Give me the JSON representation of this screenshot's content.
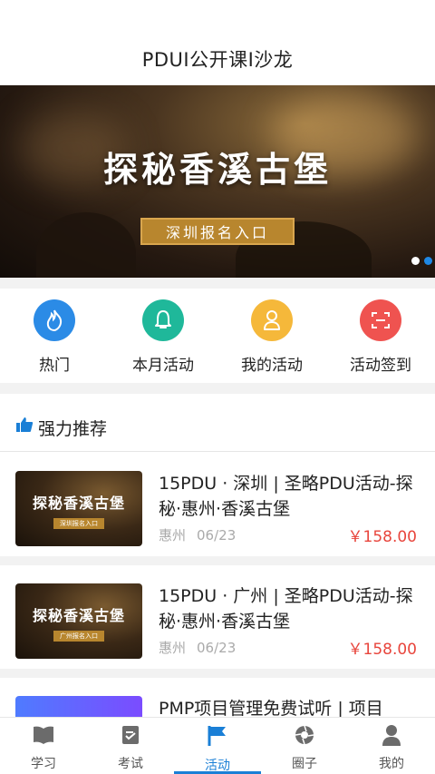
{
  "header": {
    "title": "PDUI公开课I沙龙"
  },
  "banner": {
    "title": "探秘香溪古堡",
    "button_label": "深圳报名入口"
  },
  "quick_actions": [
    {
      "label": "热门",
      "icon": "flame-icon",
      "color": "#2b8be6"
    },
    {
      "label": "本月活动",
      "icon": "bell-icon",
      "color": "#1fb89a"
    },
    {
      "label": "我的活动",
      "icon": "user-icon",
      "color": "#f5b83a"
    },
    {
      "label": "活动签到",
      "icon": "scan-icon",
      "color": "#ef5350"
    }
  ],
  "recommend": {
    "title": "强力推荐",
    "items": [
      {
        "thumb_title": "探秘香溪古堡",
        "thumb_btn": "深圳报名入口",
        "name": "15PDU · 深圳 | 圣略PDU活动-探秘·惠州·香溪古堡",
        "city": "惠州",
        "date": "06/23",
        "price": "￥158.00"
      },
      {
        "thumb_title": "探秘香溪古堡",
        "thumb_btn": "广州报名入口",
        "name": "15PDU · 广州 | 圣略PDU活动-探秘·惠州·香溪古堡",
        "city": "惠州",
        "date": "06/23",
        "price": "￥158.00"
      },
      {
        "thumb_title": "",
        "thumb_btn": "",
        "name": "PMP项目管理免费试听 | 项目",
        "city": "",
        "date": "",
        "price": ""
      }
    ]
  },
  "tabbar": [
    {
      "label": "学习",
      "icon": "book-icon"
    },
    {
      "label": "考试",
      "icon": "exam-icon"
    },
    {
      "label": "活动",
      "icon": "flag-icon",
      "active": true
    },
    {
      "label": "圈子",
      "icon": "aperture-icon"
    },
    {
      "label": "我的",
      "icon": "profile-icon"
    }
  ],
  "colors": {
    "accent": "#1a7fd6",
    "price": "#e8453c"
  }
}
